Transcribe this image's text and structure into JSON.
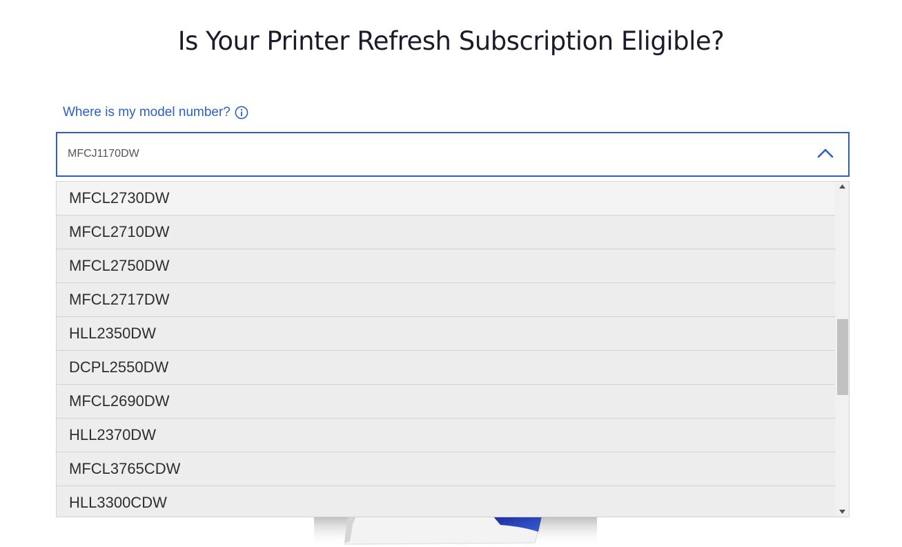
{
  "page": {
    "title": "Is Your Printer Refresh Subscription Eligible?"
  },
  "help": {
    "label": "Where is my model number?",
    "icon": "info-icon"
  },
  "model_select": {
    "selected_value": "MFCJ1170DW",
    "expanded": true,
    "accent_color": "#2a5fc6",
    "options": [
      "MFCL2730DW",
      "MFCL2710DW",
      "MFCL2750DW",
      "MFCL2717DW",
      "HLL2350DW",
      "DCPL2550DW",
      "MFCL2690DW",
      "HLL2370DW",
      "MFCL3765CDW",
      "HLL3300CDW"
    ]
  }
}
